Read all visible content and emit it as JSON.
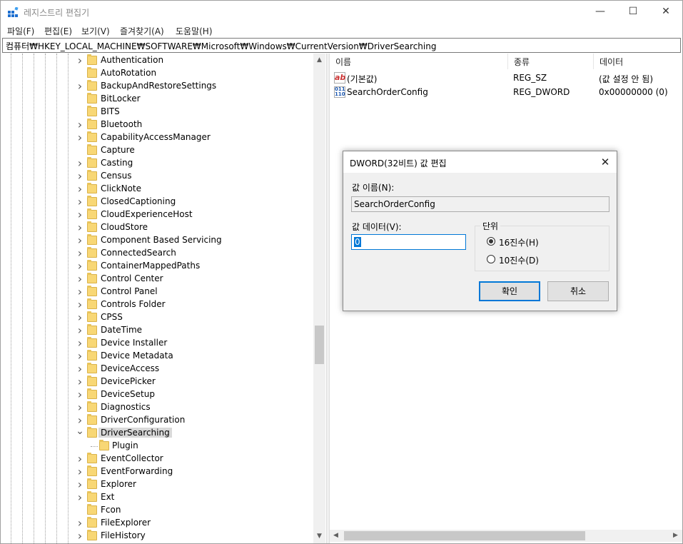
{
  "window": {
    "title": "레지스트리 편집기",
    "minimize_glyph": "—",
    "maximize_glyph": "☐",
    "close_glyph": "✕"
  },
  "menu": [
    "파일(F)",
    "편집(E)",
    "보기(V)",
    "즐겨찾기(A)",
    "도움말(H)"
  ],
  "address": "컴퓨터₩HKEY_LOCAL_MACHINE₩SOFTWARE₩Microsoft₩Windows₩CurrentVersion₩DriverSearching",
  "tree": {
    "items": [
      {
        "label": "Authentication",
        "expander": ">"
      },
      {
        "label": "AutoRotation",
        "expander": ""
      },
      {
        "label": "BackupAndRestoreSettings",
        "expander": ">"
      },
      {
        "label": "BitLocker",
        "expander": ""
      },
      {
        "label": "BITS",
        "expander": ""
      },
      {
        "label": "Bluetooth",
        "expander": ">"
      },
      {
        "label": "CapabilityAccessManager",
        "expander": ">"
      },
      {
        "label": "Capture",
        "expander": ""
      },
      {
        "label": "Casting",
        "expander": ">"
      },
      {
        "label": "Census",
        "expander": ">"
      },
      {
        "label": "ClickNote",
        "expander": ">"
      },
      {
        "label": "ClosedCaptioning",
        "expander": ">"
      },
      {
        "label": "CloudExperienceHost",
        "expander": ">"
      },
      {
        "label": "CloudStore",
        "expander": ">"
      },
      {
        "label": "Component Based Servicing",
        "expander": ">"
      },
      {
        "label": "ConnectedSearch",
        "expander": ">"
      },
      {
        "label": "ContainerMappedPaths",
        "expander": ">"
      },
      {
        "label": "Control Center",
        "expander": ">"
      },
      {
        "label": "Control Panel",
        "expander": ">"
      },
      {
        "label": "Controls Folder",
        "expander": ">"
      },
      {
        "label": "CPSS",
        "expander": ">"
      },
      {
        "label": "DateTime",
        "expander": ">"
      },
      {
        "label": "Device Installer",
        "expander": ">"
      },
      {
        "label": "Device Metadata",
        "expander": ">"
      },
      {
        "label": "DeviceAccess",
        "expander": ">"
      },
      {
        "label": "DevicePicker",
        "expander": ">"
      },
      {
        "label": "DeviceSetup",
        "expander": ">"
      },
      {
        "label": "Diagnostics",
        "expander": ">"
      },
      {
        "label": "DriverConfiguration",
        "expander": ">"
      },
      {
        "label": "DriverSearching",
        "expander": "v",
        "selected": true
      },
      {
        "label": "Plugin",
        "expander": "",
        "child": true
      },
      {
        "label": "EventCollector",
        "expander": ">"
      },
      {
        "label": "EventForwarding",
        "expander": ">"
      },
      {
        "label": "Explorer",
        "expander": ">"
      },
      {
        "label": "Ext",
        "expander": ">"
      },
      {
        "label": "Fcon",
        "expander": ""
      },
      {
        "label": "FileExplorer",
        "expander": ">"
      },
      {
        "label": "FileHistory",
        "expander": ">"
      }
    ]
  },
  "list": {
    "columns": [
      "이름",
      "종류",
      "데이터"
    ],
    "rows": [
      {
        "icon": "string-value-icon",
        "icon_text": "ab",
        "name": "(기본값)",
        "type": "REG_SZ",
        "data": "(값 설정 안 됨)"
      },
      {
        "icon": "binary-value-icon",
        "icon_text": "011\n110",
        "name": "SearchOrderConfig",
        "type": "REG_DWORD",
        "data": "0x00000000 (0)"
      }
    ]
  },
  "dialog": {
    "title": "DWORD(32비트) 값 편집",
    "value_name_label": "값 이름(N):",
    "value_name": "SearchOrderConfig",
    "value_data_label": "값 데이터(V):",
    "value_data": "0",
    "base_group_label": "단위",
    "radio_hex": "16진수(H)",
    "radio_dec": "10진수(D)",
    "selected_base": "hex",
    "ok_label": "확인",
    "cancel_label": "취소",
    "close_glyph": "✕"
  }
}
